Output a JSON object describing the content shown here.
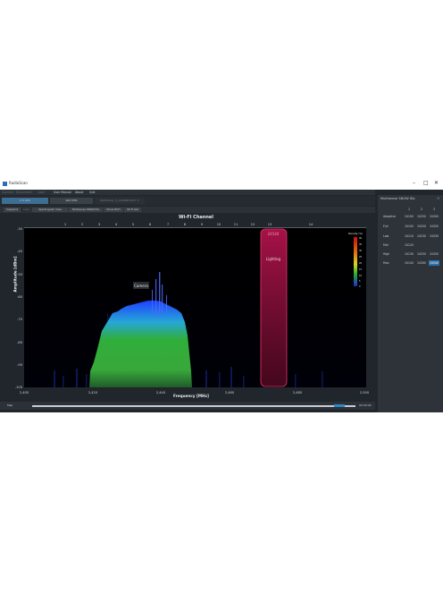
{
  "window": {
    "title": "RadioScan",
    "minimize": "–",
    "maximize": "□",
    "close": "✕"
  },
  "menu": [
    "Connect",
    "Disconnect",
    "Load",
    "User Manual",
    "About",
    "Quit"
  ],
  "tabs": [
    {
      "label": "2.4 GHz",
      "active": true
    },
    {
      "label": "900 MHz",
      "active": false
    },
    {
      "label": "RadioScan_3_120946.ktrm  ✕",
      "active": false
    }
  ],
  "views": [
    "Snapshot",
    "Stats",
    "Spectrogram View",
    "Multisense SNGW IDs",
    "Show Wi-Fi",
    "Wi-Fi List"
  ],
  "chart": {
    "title": "Wi-Fi Channel",
    "xlabel": "Frequency [MHz]",
    "ylabel": "Amplitude [dBm]",
    "channels": [
      "1",
      "2",
      "3",
      "4",
      "5",
      "6",
      "7",
      "8",
      "9",
      "10",
      "11",
      "12",
      "13",
      "14"
    ],
    "y_ticks": [
      "-30",
      "-40",
      "-50",
      "-60",
      "-70",
      "-80",
      "-90",
      "-100"
    ],
    "x_ticks": [
      "2,400",
      "2,420",
      "2,440",
      "2,460",
      "2,480",
      "2,500"
    ],
    "annotations": {
      "camera": "Camera",
      "lighting": "Lighting",
      "marker": "24540"
    },
    "legend_title": "Density (%)",
    "legend_ticks": [
      "40",
      "35",
      "30",
      "25",
      "20",
      "15",
      "10",
      "5",
      "0"
    ]
  },
  "chart_data": {
    "type": "heatmap",
    "title": "Wi-Fi Channel",
    "xlabel": "Frequency [MHz]",
    "ylabel": "Amplitude [dBm]",
    "xlim": [
      2400,
      2500
    ],
    "ylim": [
      -100,
      -30
    ],
    "colorbar": {
      "label": "Density (%)",
      "range": [
        0,
        40
      ]
    },
    "regions": [
      {
        "name": "Camera",
        "x": [
          2427,
          2448
        ],
        "y_peak": -58
      },
      {
        "name": "Lighting",
        "x": [
          2470,
          2478
        ],
        "y_peak": -30
      }
    ]
  },
  "seek": {
    "label": "Map",
    "time": "00:00:06",
    "progress": 0.94
  },
  "side_panel": {
    "title": "Multisense SNGW IDs",
    "close": "✕",
    "headers": [
      "1",
      "2",
      "3"
    ],
    "rows": [
      {
        "label": "Adaptive",
        "values": [
          "24100",
          "24250",
          "24300"
        ]
      },
      {
        "label": "Full",
        "values": [
          "24100",
          "24200",
          "24350"
        ]
      },
      {
        "label": "Low",
        "values": [
          "24110",
          "24230",
          "24330"
        ]
      },
      {
        "label": "Mid",
        "values": [
          "24120",
          "",
          ""
        ]
      },
      {
        "label": "High",
        "values": [
          "24130",
          "24250",
          "24350"
        ]
      },
      {
        "label": "Max",
        "values": [
          "24140",
          "24260",
          "24540"
        ]
      }
    ],
    "selected": {
      "row": 5,
      "col": 2
    }
  }
}
